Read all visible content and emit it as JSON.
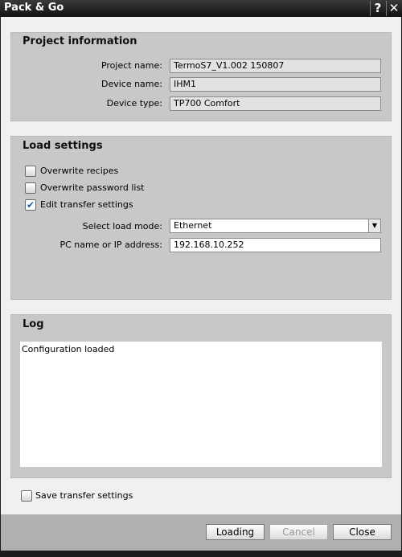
{
  "window": {
    "title": "Pack & Go",
    "help": "?",
    "close": "✕"
  },
  "project": {
    "title": "Project information",
    "fields": [
      {
        "label": "Project name:",
        "value": "TermoS7_V1.002 150807"
      },
      {
        "label": "Device name:",
        "value": "IHM1"
      },
      {
        "label": "Device type:",
        "value": "TP700 Comfort"
      }
    ]
  },
  "load": {
    "title": "Load settings",
    "checkboxes": [
      {
        "label": "Overwrite recipes",
        "checked": false
      },
      {
        "label": "Overwrite password list",
        "checked": false
      },
      {
        "label": "Edit transfer settings",
        "checked": true
      }
    ],
    "mode_label": "Select load mode:",
    "mode_value": "Ethernet",
    "ip_label": "PC name or IP address:",
    "ip_value": "192.168.10.252"
  },
  "log": {
    "title": "Log",
    "text": "Configuration loaded"
  },
  "save": {
    "label": "Save transfer settings",
    "checked": false
  },
  "buttons": {
    "loading": "Loading",
    "cancel": "Cancel",
    "close": "Close"
  }
}
